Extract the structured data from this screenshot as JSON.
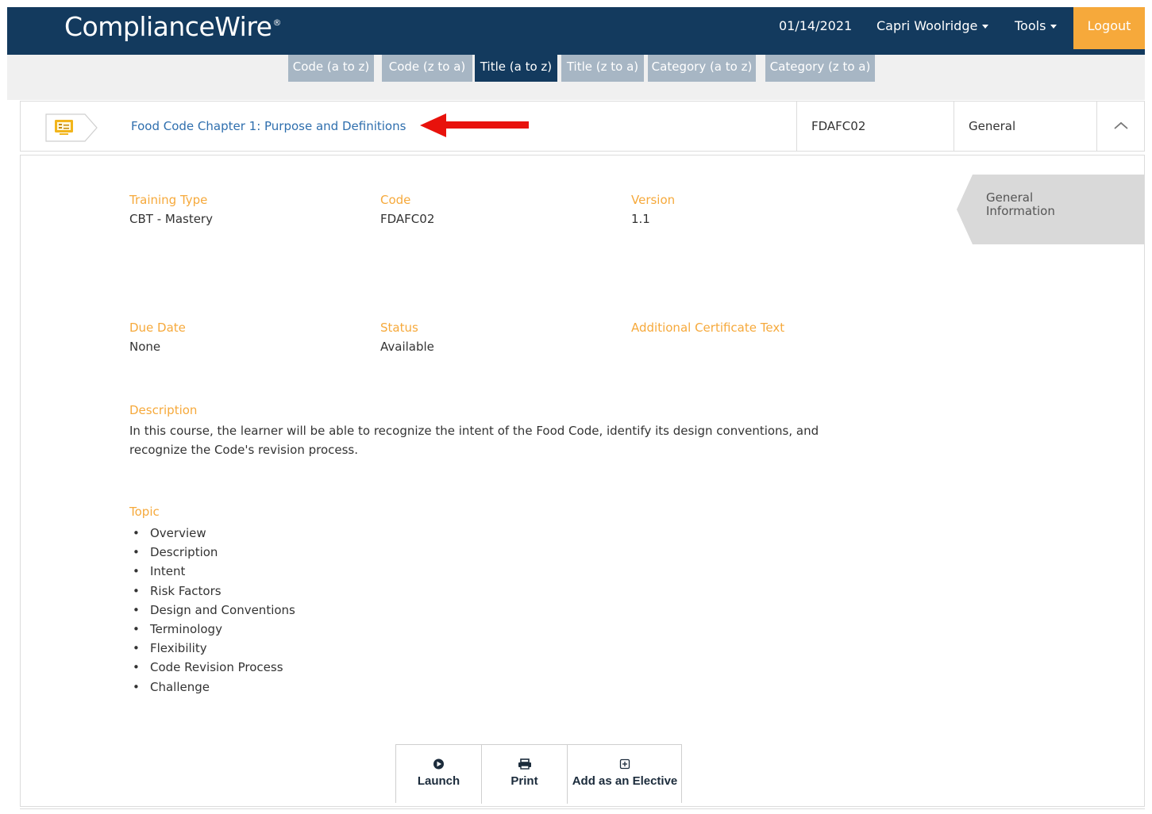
{
  "header": {
    "brand": "ComplianceWire",
    "brand_mark": "®",
    "date": "01/14/2021",
    "user_menu": "Capri Woolridge",
    "tools_menu": "Tools",
    "logout": "Logout"
  },
  "sort_options": [
    {
      "label": "Code (a to z)",
      "active": false
    },
    {
      "label": "Code (z to a)",
      "active": false
    },
    {
      "label": "Title (a to z)",
      "active": true
    },
    {
      "label": "Title (z to a)",
      "active": false
    },
    {
      "label": "Category (a to z)",
      "active": false
    },
    {
      "label": "Category (z to a)",
      "active": false
    }
  ],
  "course": {
    "title": "Food Code Chapter 1: Purpose and Definitions",
    "code": "FDAFC02",
    "category": "General",
    "icon": "presentation-icon",
    "annotation": "red-arrow-icon"
  },
  "details": {
    "section_tab": "General Information",
    "training_type_label": "Training Type",
    "training_type": "CBT - Mastery",
    "code_label": "Code",
    "code": "FDAFC02",
    "version_label": "Version",
    "version": "1.1",
    "due_date_label": "Due Date",
    "due_date": "None",
    "status_label": "Status",
    "status": "Available",
    "cert_text_label": "Additional Certificate Text",
    "description_label": "Description",
    "description": "In this course, the learner will be able to recognize the intent of the Food Code, identify its design conventions, and recognize the Code's revision process.",
    "topic_label": "Topic",
    "topics": [
      "Overview",
      "Description",
      "Intent",
      "Risk Factors",
      "Design and Conventions",
      "Terminology",
      "Flexibility",
      "Code Revision Process",
      "Challenge"
    ]
  },
  "actions": {
    "launch": "Launch",
    "print": "Print",
    "elective": "Add as an Elective"
  },
  "colors": {
    "navy": "#133a5e",
    "accent_orange": "#f6a93b",
    "link_blue": "#2f6fae",
    "sort_inactive": "#a7b6c4",
    "annotation_red": "#e8120c"
  }
}
